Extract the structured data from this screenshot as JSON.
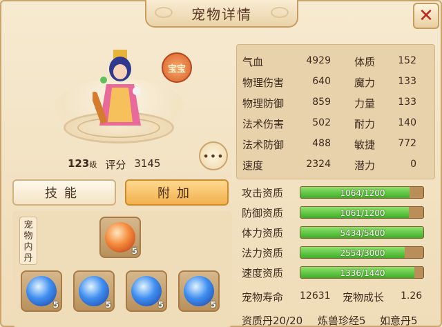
{
  "title": "宠物详情",
  "close_icon": "close-x",
  "badge": "宝宝",
  "level": "123",
  "level_suffix": "级",
  "score_label": "评分",
  "score": "3145",
  "more_label": "•••",
  "tabs": {
    "skill": "技能",
    "extra": "附加"
  },
  "neidan_label": "宠物内丹",
  "slots": [
    {
      "icon": "red-orb",
      "count": "5"
    },
    {
      "icon": "blue-orb",
      "count": "5"
    },
    {
      "icon": "blue-orb",
      "count": "5"
    },
    {
      "icon": "blue-orb",
      "count": "5"
    },
    {
      "icon": "blue-orb",
      "count": "5"
    }
  ],
  "stats": [
    {
      "label": "气血",
      "value": "4929",
      "label2": "体质",
      "value2": "152"
    },
    {
      "label": "物理伤害",
      "value": "640",
      "label2": "魔力",
      "value2": "133"
    },
    {
      "label": "物理防御",
      "value": "859",
      "label2": "力量",
      "value2": "133"
    },
    {
      "label": "法术伤害",
      "value": "502",
      "label2": "耐力",
      "value2": "140"
    },
    {
      "label": "法术防御",
      "value": "488",
      "label2": "敏捷",
      "value2": "772"
    },
    {
      "label": "速度",
      "value": "2324",
      "label2": "潜力",
      "value2": "0"
    }
  ],
  "aptitudes": [
    {
      "label": "攻击资质",
      "text": "1064/1200",
      "percent": 88.7
    },
    {
      "label": "防御资质",
      "text": "1061/1200",
      "percent": 88.4
    },
    {
      "label": "体力资质",
      "text": "5434/5400",
      "percent": 100
    },
    {
      "label": "法力资质",
      "text": "2554/3000",
      "percent": 85.1
    },
    {
      "label": "速度资质",
      "text": "1336/1440",
      "percent": 92.8
    }
  ],
  "lifespan_label": "宠物寿命",
  "lifespan": "12631",
  "growth_label": "宠物成长",
  "growth": "1.26",
  "footer": {
    "pill": "资质丹20/20",
    "beast": "炼兽珍经5",
    "ruyi": "如意丹5"
  },
  "colors": {
    "accent_green": "#3fae2a",
    "close_red": "#c0281c",
    "tab_active": "#f1b04e"
  }
}
